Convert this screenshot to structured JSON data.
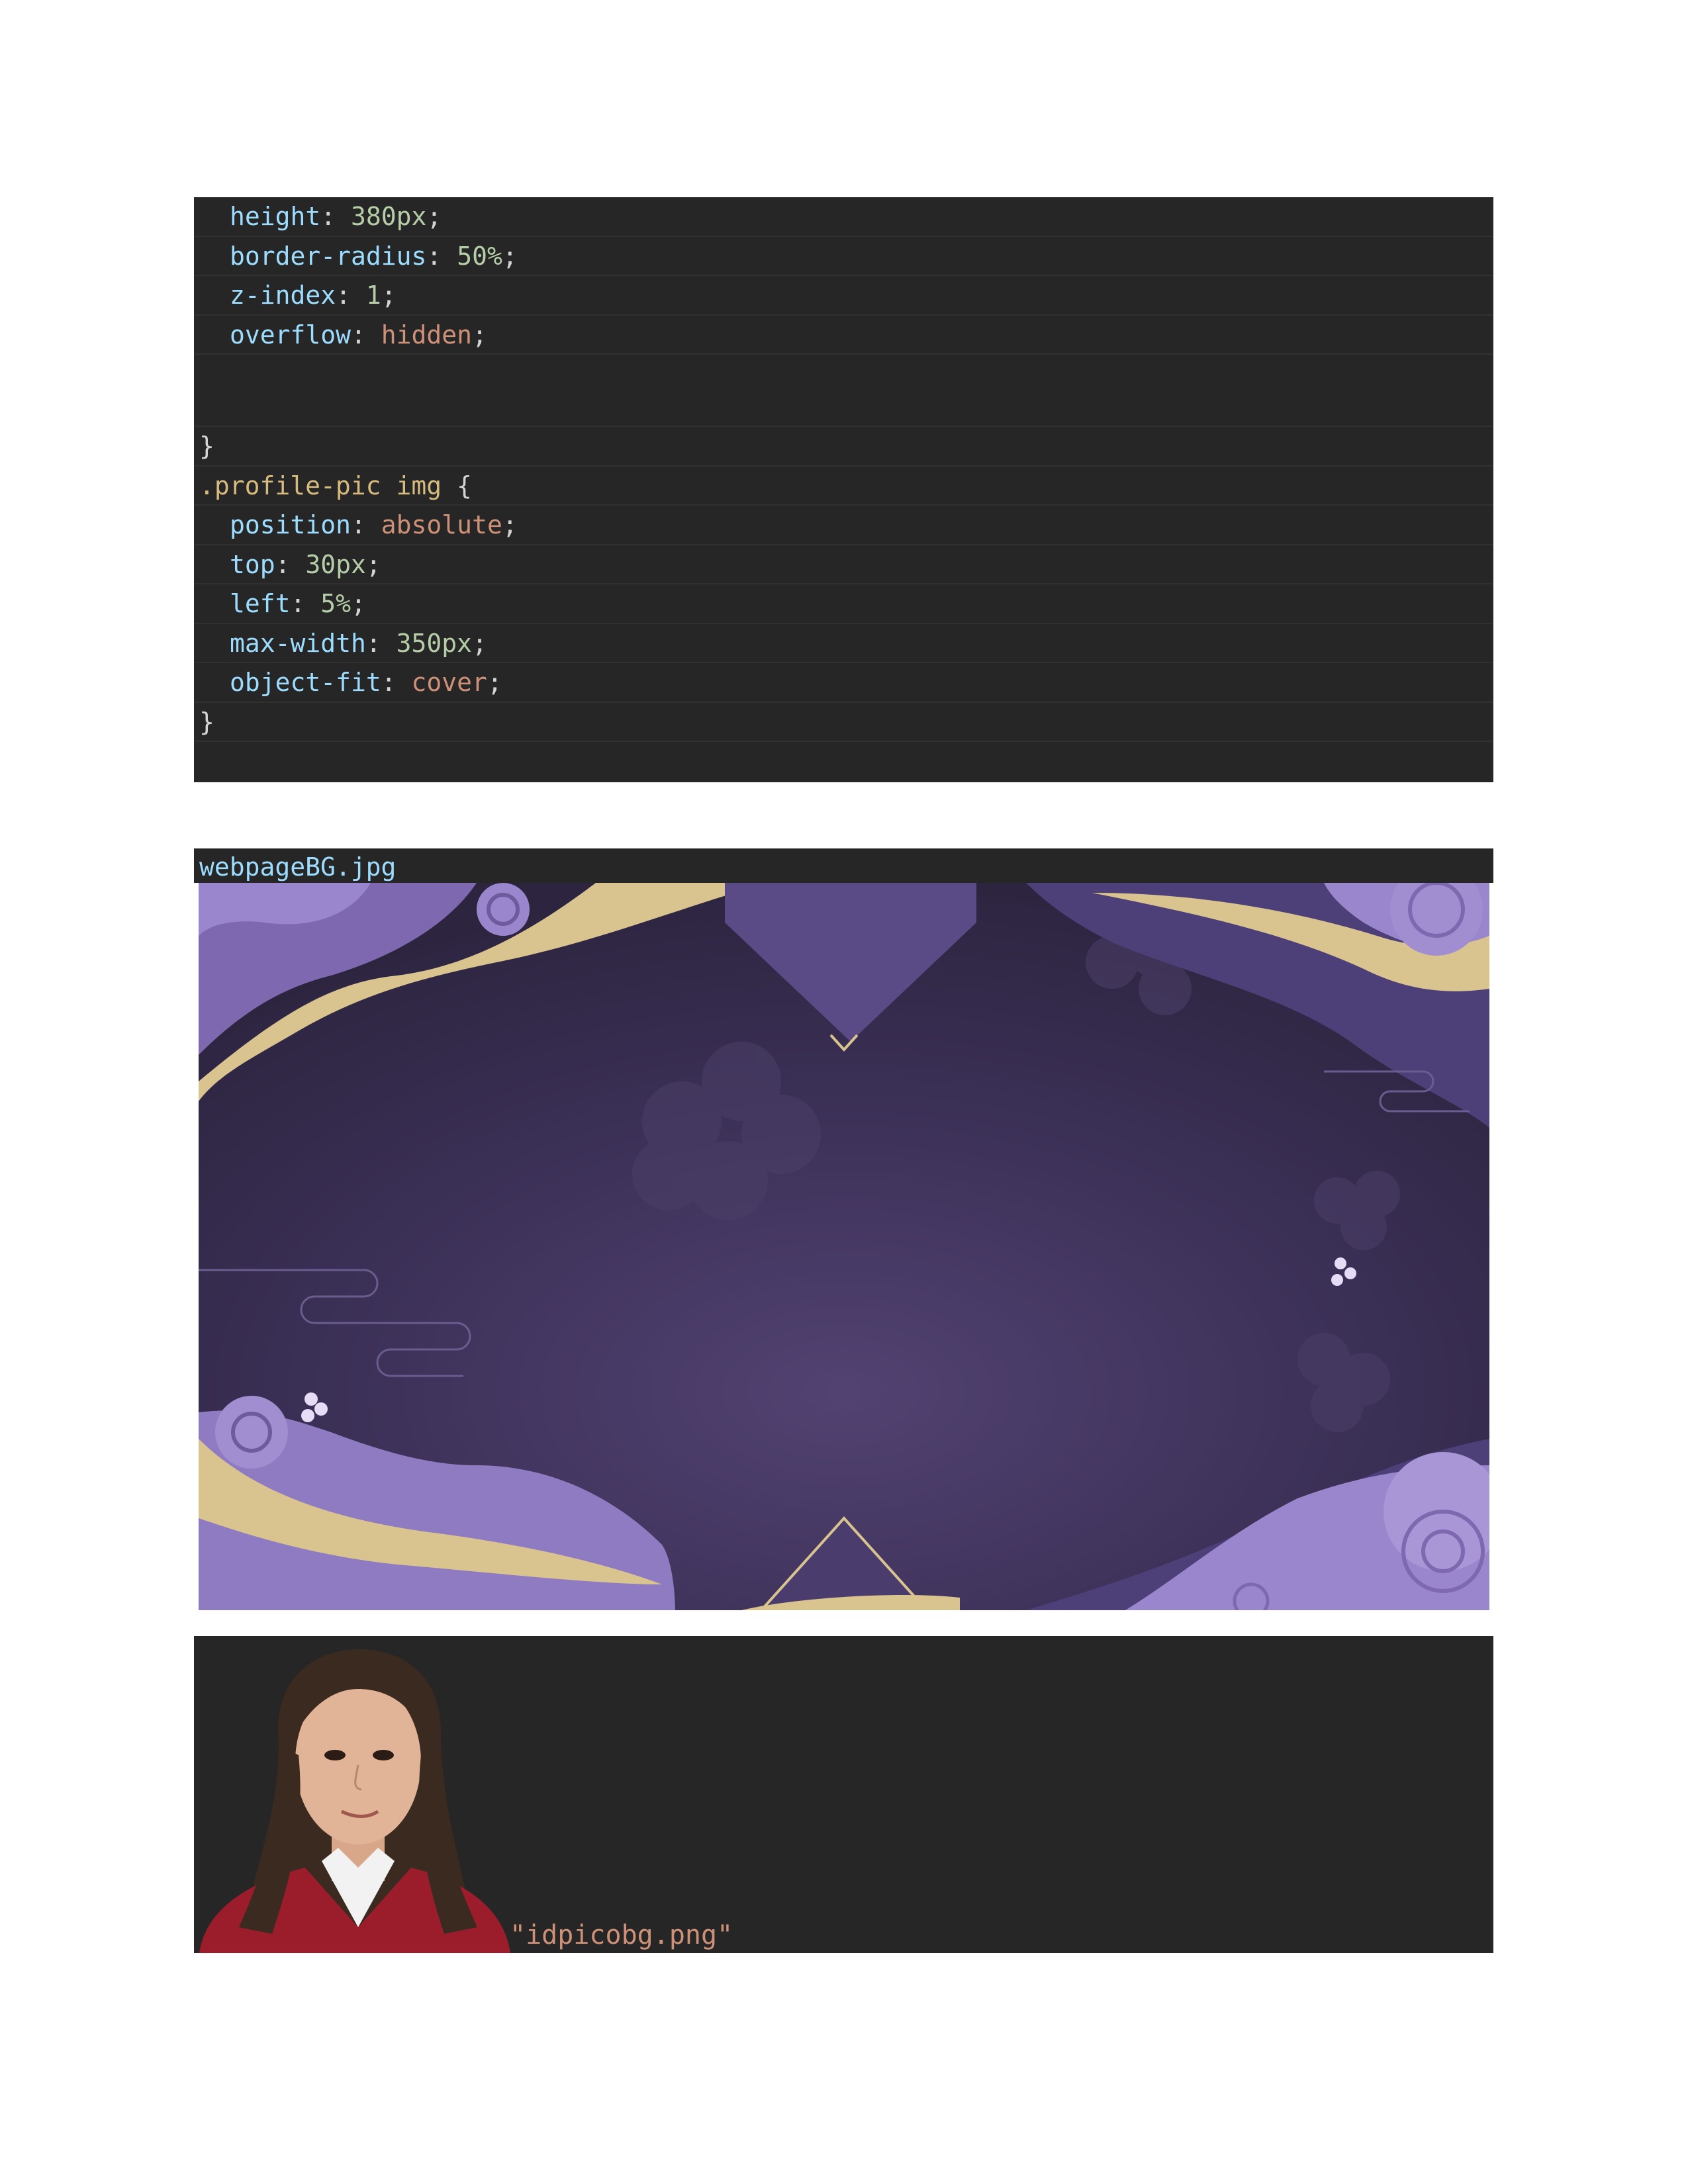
{
  "code": {
    "lines": [
      {
        "prop": "height",
        "value": "380px"
      },
      {
        "prop": "border-radius",
        "value": "50%"
      },
      {
        "prop": "z-index",
        "value": "1"
      },
      {
        "prop": "overflow",
        "value": "hidden"
      },
      {
        "close": "}"
      },
      {
        "selector": ".profile-pic",
        "tag": "img",
        "brace": "{"
      },
      {
        "prop": "position",
        "value": "absolute"
      },
      {
        "prop": "top",
        "value": "30px"
      },
      {
        "prop": "left",
        "value": "5%"
      },
      {
        "prop": "max-width",
        "value": "350px"
      },
      {
        "prop": "object-fit",
        "value": "cover"
      },
      {
        "close": "}"
      }
    ]
  },
  "background_image": {
    "filename": "webpageBG.jpg"
  },
  "profile_image": {
    "filename": "\"idpicobg.png\""
  }
}
